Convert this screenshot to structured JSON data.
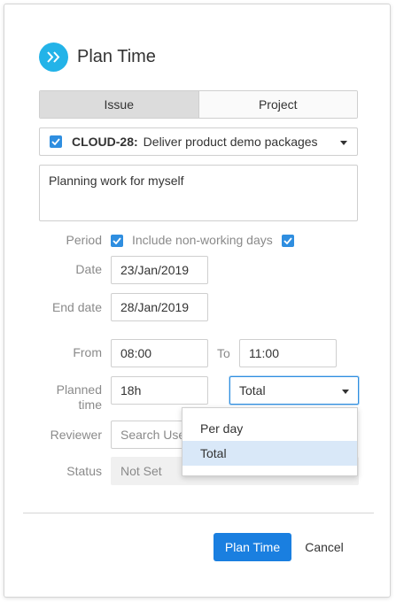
{
  "dialog": {
    "title": "Plan Time",
    "icon": "double-chevron-right-icon",
    "accent_color": "#23b3e8"
  },
  "tabs": [
    {
      "label": "Issue",
      "active": true
    },
    {
      "label": "Project",
      "active": false
    }
  ],
  "issue": {
    "checked": true,
    "key": "CLOUD-28:",
    "summary": "Deliver product demo packages"
  },
  "description": "Planning work for myself",
  "period": {
    "label": "Period",
    "checked": true,
    "include_nonworking_label": "Include non-working days",
    "include_nonworking_checked": true
  },
  "date": {
    "label": "Date",
    "value": "23/Jan/2019"
  },
  "end_date": {
    "label": "End date",
    "value": "28/Jan/2019"
  },
  "from": {
    "label": "From",
    "value": "08:00"
  },
  "to": {
    "label": "To",
    "value": "11:00"
  },
  "planned_time": {
    "label_line1": "Planned",
    "label_line2": "time",
    "value": "18h",
    "mode_selected": "Total",
    "options": [
      "Per day",
      "Total"
    ]
  },
  "reviewer": {
    "label": "Reviewer",
    "placeholder": "Search Use"
  },
  "status": {
    "label": "Status",
    "value": "Not Set"
  },
  "footer": {
    "primary_label": "Plan Time",
    "primary_color": "#1a7fe0",
    "cancel_label": "Cancel"
  }
}
